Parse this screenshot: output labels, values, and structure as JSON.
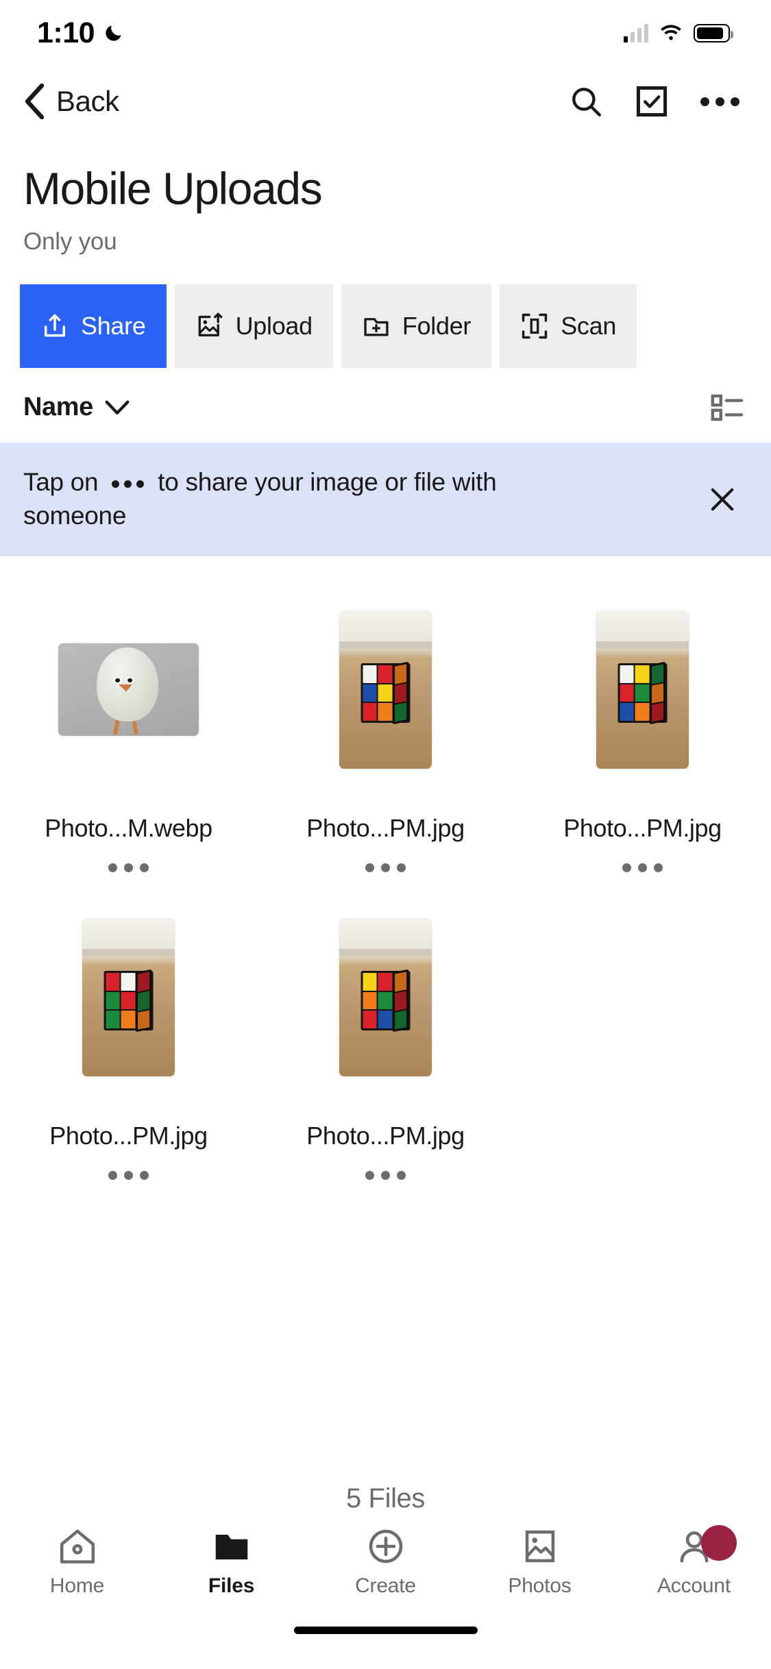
{
  "status_bar": {
    "time": "1:10",
    "dnd_icon": "crescent-moon-icon",
    "signal_icon": "cellular-signal-icon",
    "wifi_icon": "wifi-icon",
    "battery_icon": "battery-icon"
  },
  "navbar": {
    "back_label": "Back",
    "back_icon": "chevron-left-icon",
    "search_icon": "search-icon",
    "select_icon": "checkbox-select-icon",
    "overflow_icon": "more-horizontal-icon"
  },
  "header": {
    "title": "Mobile Uploads",
    "subtitle": "Only you"
  },
  "actions": [
    {
      "label": "Share",
      "icon": "share-upload-icon",
      "primary": true
    },
    {
      "label": "Upload",
      "icon": "image-upload-icon",
      "primary": false
    },
    {
      "label": "Folder",
      "icon": "folder-plus-icon",
      "primary": false
    },
    {
      "label": "Scan",
      "icon": "scan-document-icon",
      "primary": false
    }
  ],
  "sort": {
    "label": "Name",
    "chevron_icon": "chevron-down-icon",
    "view_toggle_icon": "list-view-icon"
  },
  "banner": {
    "text_before": "Tap on",
    "text_after": "to share your image or file with someone",
    "dots_icon": "more-horizontal-icon",
    "close_icon": "close-icon",
    "background": "#dbe2f8"
  },
  "files": [
    {
      "name": "Photo...M.webp",
      "art": "egg",
      "shape": "wide",
      "menu_icon": "more-horizontal-icon"
    },
    {
      "name": "Photo...PM.jpg",
      "art": "cube",
      "shape": "tall",
      "menu_icon": "more-horizontal-icon"
    },
    {
      "name": "Photo...PM.jpg",
      "art": "cube",
      "shape": "tall",
      "menu_icon": "more-horizontal-icon"
    },
    {
      "name": "Photo...PM.jpg",
      "art": "cube",
      "shape": "tall",
      "menu_icon": "more-horizontal-icon"
    },
    {
      "name": "Photo...PM.jpg",
      "art": "cube",
      "shape": "tall",
      "menu_icon": "more-horizontal-icon"
    }
  ],
  "file_count": "5 Files",
  "tabs": [
    {
      "label": "Home",
      "icon": "home-icon",
      "active": false,
      "badge": false
    },
    {
      "label": "Files",
      "icon": "folder-icon",
      "active": true,
      "badge": false
    },
    {
      "label": "Create",
      "icon": "plus-circle-icon",
      "active": false,
      "badge": false
    },
    {
      "label": "Photos",
      "icon": "photo-icon",
      "active": false,
      "badge": false
    },
    {
      "label": "Account",
      "icon": "person-icon",
      "active": false,
      "badge": true
    }
  ],
  "colors": {
    "primary": "#2962f5",
    "chip_bg": "#eeedeb",
    "banner_bg": "#dbe2f8",
    "badge": "#9b2242",
    "muted_text": "#6e6b68"
  }
}
